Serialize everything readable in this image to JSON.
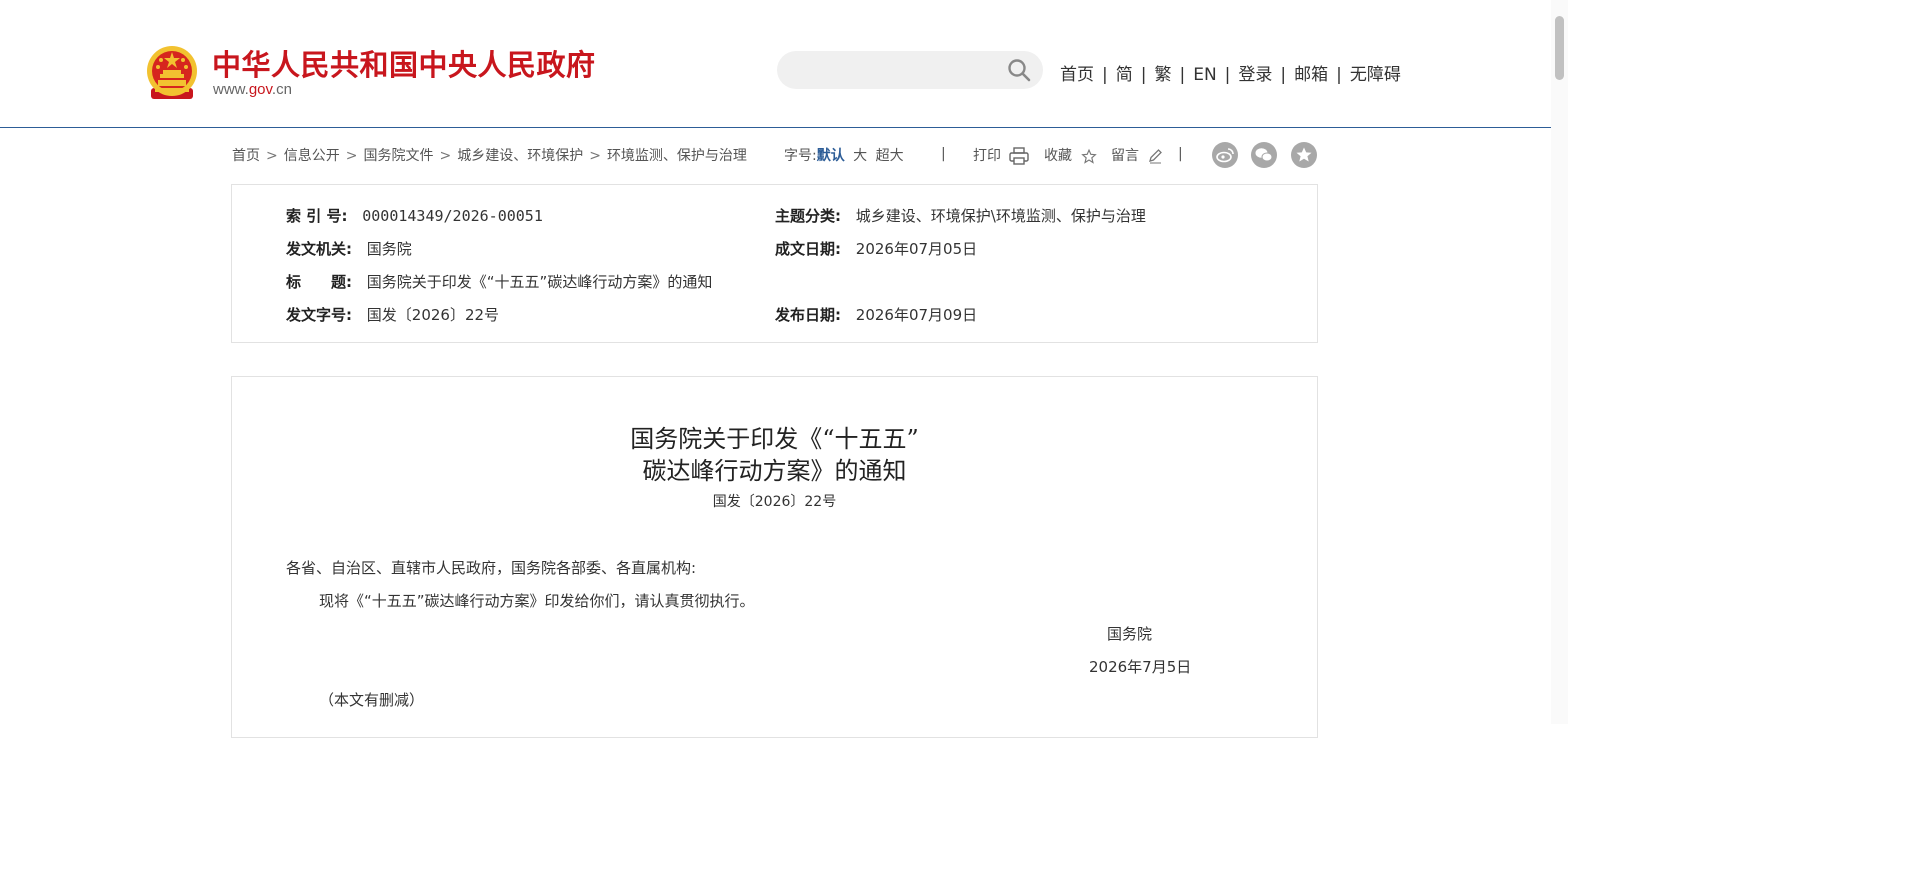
{
  "header": {
    "site_title": "中华人民共和国中央人民政府",
    "domain_pre": "www.",
    "domain_gov": "gov",
    "domain_post": ".cn",
    "search_placeholder": "",
    "nav": [
      "首页",
      "简",
      "繁",
      "EN",
      "登录",
      "邮箱",
      "无障碍"
    ]
  },
  "breadcrumb": [
    "首页",
    "信息公开",
    "国务院文件",
    "城乡建设、环境保护",
    "环境监测、保护与治理"
  ],
  "font_size": {
    "label": "字号:",
    "options": [
      "默认",
      "大",
      "超大"
    ],
    "active": "默认"
  },
  "tools": {
    "print": "打印",
    "favorite": "收藏",
    "comment": "留言"
  },
  "share_icons": [
    "weibo-icon",
    "wechat-icon",
    "star-share-icon"
  ],
  "meta": {
    "index_label": "索 引 号:",
    "index_value": "000014349/2026-00051",
    "topic_label": "主题分类:",
    "topic_value": "城乡建设、环境保护\\环境监测、保护与治理",
    "issuer_label": "发文机关:",
    "issuer_value": "国务院",
    "written_label": "成文日期:",
    "written_value": "2026年07月05日",
    "title_label": "标　　题:",
    "title_value": "国务院关于印发《“十五五”碳达峰行动方案》的通知",
    "docno_label": "发文字号:",
    "docno_value": "国发〔2026〕22号",
    "publish_label": "发布日期:",
    "publish_value": "2026年07月09日"
  },
  "document": {
    "title_line1": "国务院关于印发《“十五五”",
    "title_line2": "碳达峰行动方案》的通知",
    "doc_no": "国发〔2026〕22号",
    "addressee": "各省、自治区、直辖市人民政府，国务院各部委、各直属机构:",
    "body": "现将《“十五五”碳达峰行动方案》印发给你们，请认真贯彻执行。",
    "signer": "国务院",
    "date": "2026年7月5日",
    "note": "（本文有删减）"
  },
  "colors": {
    "brand_red": "#c8161d",
    "accent_blue": "#2d5d97",
    "emblem_gold": "#f2c230"
  }
}
